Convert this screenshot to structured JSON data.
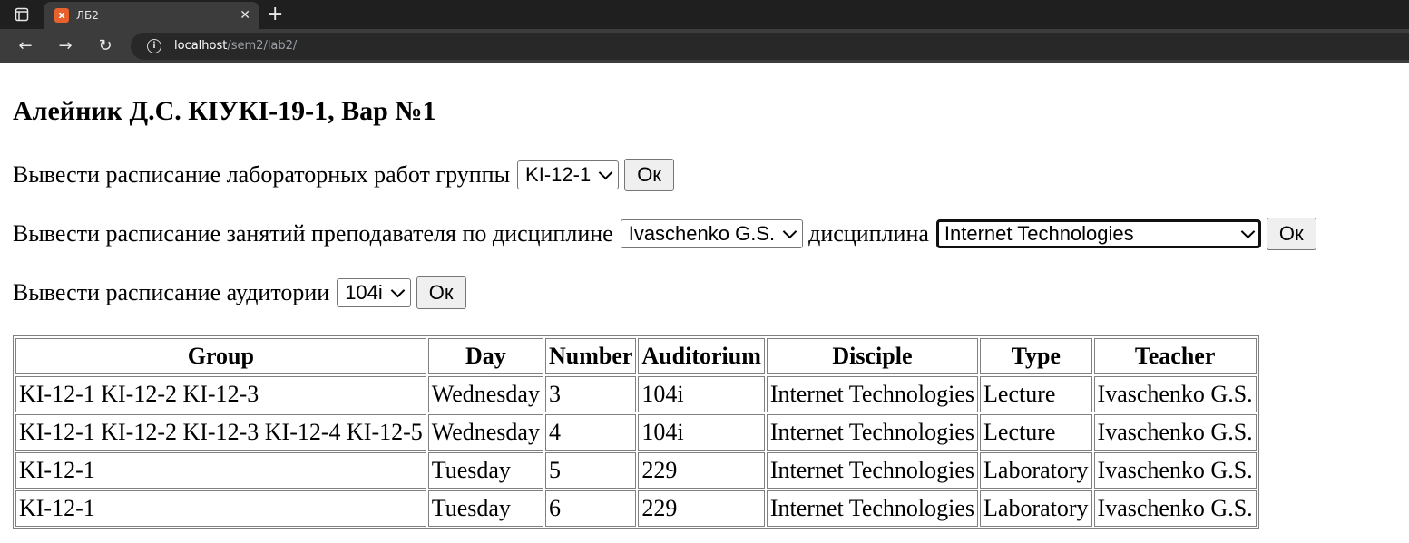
{
  "browser": {
    "tab_title": "ЛБ2",
    "favicon_glyph": "x",
    "url_host": "localhost",
    "url_path": "/sem2/lab2/"
  },
  "page": {
    "heading": "Алейник Д.С. КІУКІ-19-1, Вар №1",
    "group_form": {
      "label": "Вывести расписание лабораторных работ группы",
      "selected": "KI-12-1",
      "button": "Ок"
    },
    "teacher_form": {
      "label": "Вывести расписание занятий преподавателя по дисциплине",
      "teacher_selected": "Ivaschenko G.S.",
      "discipline_label": "дисциплина",
      "discipline_selected": "Internet Technologies",
      "button": "Ок"
    },
    "room_form": {
      "label": "Вывести расписание аудитории",
      "selected": "104i",
      "button": "Ок"
    }
  },
  "table": {
    "headers": [
      "Group",
      "Day",
      "Number",
      "Auditorium",
      "Disciple",
      "Type",
      "Teacher"
    ],
    "rows": [
      [
        "KI-12-1 KI-12-2 KI-12-3",
        "Wednesday",
        "3",
        "104i",
        "Internet Technologies",
        "Lecture",
        "Ivaschenko G.S."
      ],
      [
        "KI-12-1 KI-12-2 KI-12-3 KI-12-4 KI-12-5",
        "Wednesday",
        "4",
        "104i",
        "Internet Technologies",
        "Lecture",
        "Ivaschenko G.S."
      ],
      [
        "KI-12-1",
        "Tuesday",
        "5",
        "229",
        "Internet Technologies",
        "Laboratory",
        "Ivaschenko G.S."
      ],
      [
        "KI-12-1",
        "Tuesday",
        "6",
        "229",
        "Internet Technologies",
        "Laboratory",
        "Ivaschenko G.S."
      ]
    ]
  }
}
